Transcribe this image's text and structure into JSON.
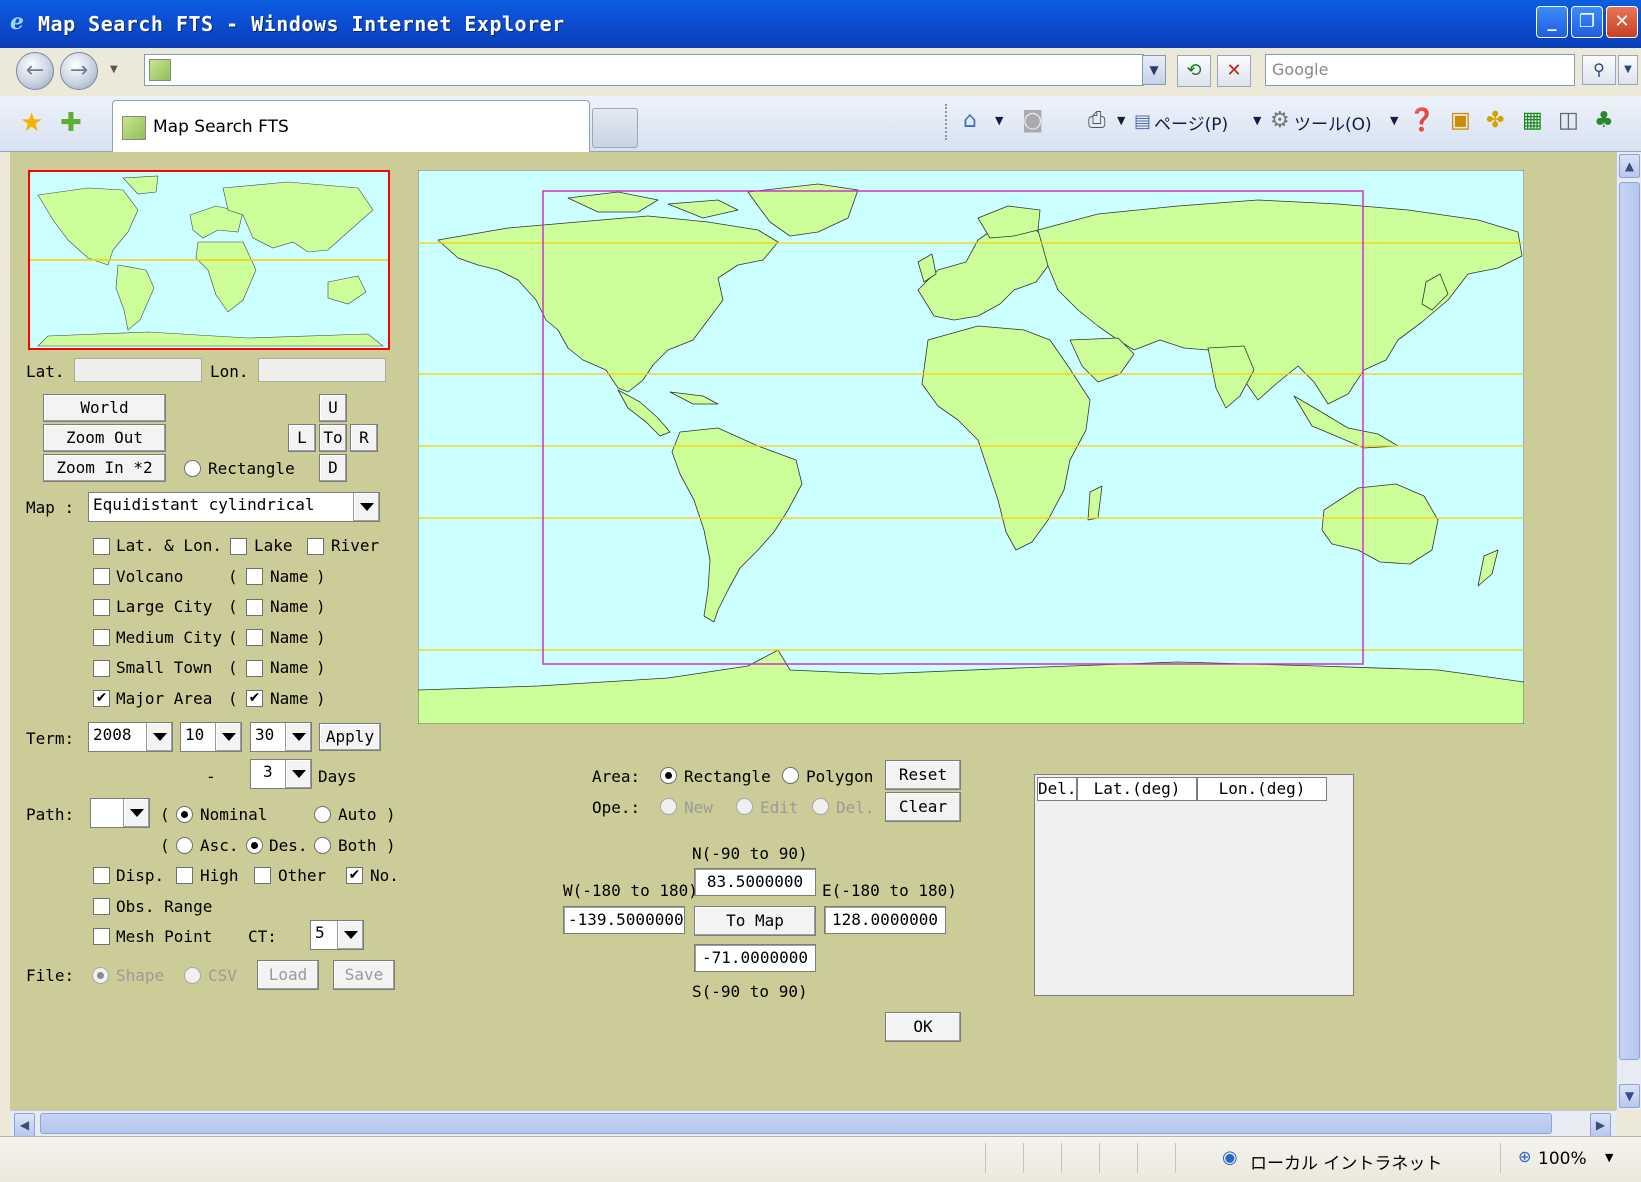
{
  "window": {
    "title": "Map Search FTS - Windows Internet Explorer",
    "minimize": "_",
    "restore": "❐",
    "close": "✕"
  },
  "address": {
    "url": "",
    "search_placeholder": "Google"
  },
  "tab": {
    "title": "Map Search FTS"
  },
  "commands": {
    "page": "ページ(P)",
    "tools": "ツール(O)"
  },
  "status": {
    "zone": "ローカル イントラネット",
    "zoom": "100%"
  },
  "panel": {
    "lat_label": "Lat.",
    "lon_label": "Lon.",
    "lat_value": "",
    "lon_value": "",
    "world": "World",
    "zoom_out": "Zoom Out",
    "zoom_in": "Zoom In *2",
    "rectangle": "Rectangle",
    "nav": {
      "u": "U",
      "l": "L",
      "to": "To",
      "r": "R",
      "d": "D"
    },
    "map_label": "Map :",
    "map_value": "Equidistant cylindrical",
    "layers": {
      "lat_lon": "Lat. & Lon.",
      "lake": "Lake",
      "river": "River",
      "volcano": "Volcano",
      "large_city": "Large City",
      "medium_city": "Medium City",
      "small_town": "Small Town",
      "major_area": "Major Area",
      "name": "Name",
      "paren_open": "(",
      "paren_close": ")"
    },
    "term": {
      "label": "Term:",
      "year": "2008",
      "month": "10",
      "day": "30",
      "apply": "Apply",
      "dash": "-",
      "days_value": "3",
      "days_label": "Days"
    },
    "path": {
      "label": "Path:",
      "value": "",
      "nominal": "Nominal",
      "auto": "Auto",
      "asc": "Asc.",
      "des": "Des.",
      "both": "Both"
    },
    "disp": {
      "disp": "Disp.",
      "high": "High",
      "other": "Other",
      "no": "No.",
      "obs_range": "Obs. Range",
      "mesh_point": "Mesh Point",
      "ct_label": "CT:",
      "ct_value": "5"
    },
    "file": {
      "label": "File:",
      "shape": "Shape",
      "csv": "CSV",
      "load": "Load",
      "save": "Save"
    }
  },
  "area": {
    "area_label": "Area:",
    "rectangle": "Rectangle",
    "polygon": "Polygon",
    "reset": "Reset",
    "ope_label": "Ope.:",
    "new": "New",
    "edit": "Edit",
    "del": "Del.",
    "clear": "Clear",
    "n_label": "N(-90 to 90)",
    "w_label": "W(-180 to 180)",
    "e_label": "E(-180 to 180)",
    "s_label": "S(-90 to 90)",
    "north": "83.5000000",
    "west": "-139.5000000",
    "east": "128.0000000",
    "south": "-71.0000000",
    "to_map": "To Map",
    "ok": "OK"
  },
  "grid": {
    "headers": [
      "Del.",
      "Lat.(deg)",
      "Lon.(deg)"
    ]
  },
  "colors": {
    "panel_bg": "#cccc99",
    "ocean": "#ccffff",
    "land": "#ccff99",
    "lat_lines": "#ffcc00",
    "selection": "#cc33cc",
    "minimap_border": "#ff0000"
  }
}
